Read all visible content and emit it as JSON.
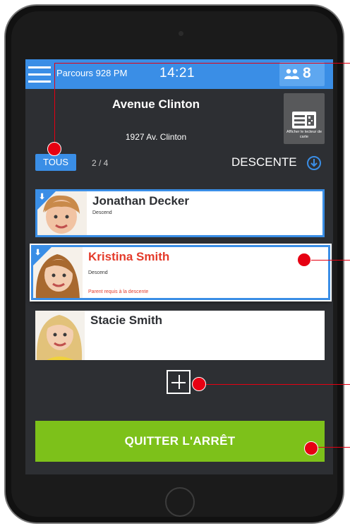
{
  "topbar": {
    "route": "Parcours 928 PM",
    "time": "14:21",
    "rider_count": "8",
    "riders_icon": "users-icon",
    "menu_icon": "hamburger-menu-icon"
  },
  "stop": {
    "name": "Avenue Clinton",
    "address": "1927 Av. Clinton"
  },
  "card_reader": {
    "label": "Afficher le lecteur de carte",
    "icon": "card-reader-icon"
  },
  "filter": {
    "tous": "TOUS",
    "pager": "2 / 4",
    "direction": "DESCENTE",
    "direction_icon": "arrow-down-circle-icon"
  },
  "riders": [
    {
      "name": "Jonathan Decker",
      "status": "Descend",
      "warning": ""
    },
    {
      "name": "Kristina Smith",
      "status": "Descend",
      "warning": "Parent requis à la descente"
    },
    {
      "name": "Stacie Smith",
      "status": "",
      "warning": ""
    }
  ],
  "add_button": {
    "icon": "plus-icon"
  },
  "quit_button": {
    "label": "QUITTER L'ARRÊT"
  },
  "colors": {
    "accent": "#3a8ee6",
    "alert": "#e43b2b",
    "go": "#7dc11a",
    "screen": "#2d2f33",
    "callout": "#e60012"
  }
}
